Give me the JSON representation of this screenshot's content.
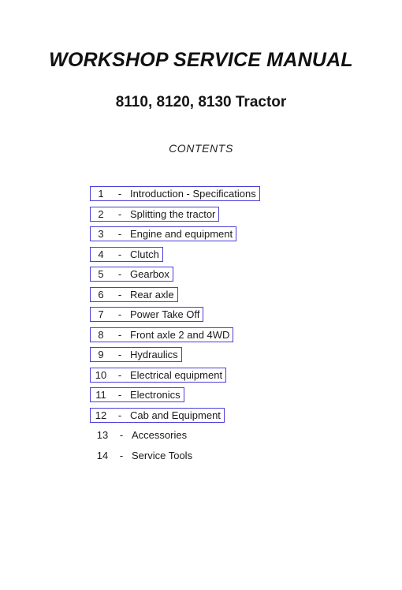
{
  "document": {
    "title": "WORKSHOP SERVICE MANUAL",
    "subtitle": "8110, 8120, 8130 Tractor",
    "contents_heading": "CONTENTS"
  },
  "style": {
    "link_border_color": "#4a3fd6",
    "page_background": "#ffffff",
    "text_color": "#1a1a1a"
  },
  "contents": {
    "separator": "-",
    "items": [
      {
        "number": "1",
        "label": "Introduction - Specifications",
        "linked": true
      },
      {
        "number": "2",
        "label": "Splitting the tractor",
        "linked": true
      },
      {
        "number": "3",
        "label": "Engine and equipment",
        "linked": true
      },
      {
        "number": "4",
        "label": "Clutch",
        "linked": true
      },
      {
        "number": "5",
        "label": "Gearbox",
        "linked": true
      },
      {
        "number": "6",
        "label": "Rear axle",
        "linked": true
      },
      {
        "number": "7",
        "label": "Power Take Off",
        "linked": true
      },
      {
        "number": "8",
        "label": "Front axle 2 and 4WD",
        "linked": true
      },
      {
        "number": "9",
        "label": "Hydraulics",
        "linked": true
      },
      {
        "number": "10",
        "label": "Electrical equipment",
        "linked": true
      },
      {
        "number": "11",
        "label": "Electronics",
        "linked": true
      },
      {
        "number": "12",
        "label": "Cab and Equipment",
        "linked": true
      },
      {
        "number": "13",
        "label": "Accessories",
        "linked": false
      },
      {
        "number": "14",
        "label": "Service Tools",
        "linked": false
      }
    ]
  }
}
